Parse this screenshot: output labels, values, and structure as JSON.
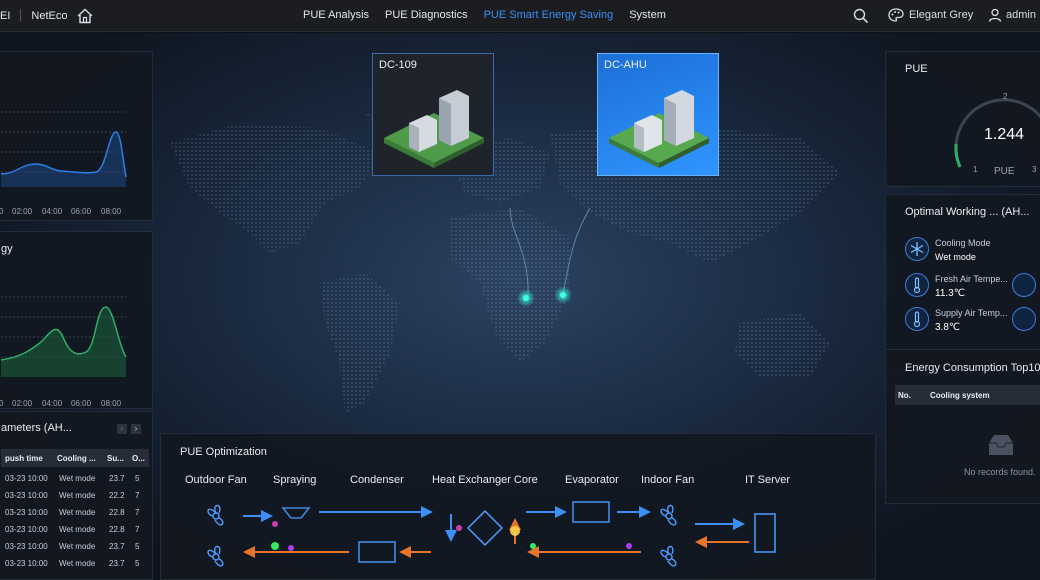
{
  "topbar": {
    "brand": "EI",
    "product": "NetEco",
    "nav": [
      "PUE Analysis",
      "PUE Diagnostics",
      "PUE Smart Energy Saving",
      "System"
    ],
    "active_nav": "PUE Smart Energy Saving",
    "theme": "Elegant Grey",
    "user": "admin"
  },
  "left_panels": {
    "panel2_title": "gy",
    "chart1_ticks": [
      "0",
      "02:00",
      "04:00",
      "06:00",
      "08:00"
    ],
    "chart2_ticks": [
      "0",
      "02:00",
      "04:00",
      "06:00",
      "08:00"
    ],
    "params_title": "ameters (AH...",
    "params_columns": [
      "push time",
      "Cooling ...",
      "Su...",
      "O..."
    ],
    "params_rows": [
      [
        "03-23 10:00",
        "Wet mode",
        "23.7",
        "5"
      ],
      [
        "03-23 10:00",
        "Wet mode",
        "22.2",
        "7"
      ],
      [
        "03-23 10:00",
        "Wet mode",
        "22.8",
        "7"
      ],
      [
        "03-23 10:00",
        "Wet mode",
        "22.8",
        "7"
      ],
      [
        "03-23 10:00",
        "Wet mode",
        "23.7",
        "5"
      ],
      [
        "03-23 10:00",
        "Wet mode",
        "23.7",
        "5"
      ]
    ]
  },
  "dc_cards": [
    {
      "label": "DC-109",
      "selected": false
    },
    {
      "label": "DC-AHU",
      "selected": true
    }
  ],
  "pue": {
    "title": "PUE",
    "value": "1.244",
    "unit": "PUE",
    "scale": [
      "1",
      "2",
      "3"
    ]
  },
  "working": {
    "title": "Optimal Working ... (AH...",
    "items": [
      {
        "name": "Cooling Mode",
        "value": "Wet mode",
        "icon": "snowflake-icon"
      },
      {
        "name": "Fresh Air Tempe...",
        "value": "11.3℃",
        "icon": "thermometer-icon"
      },
      {
        "name": "Supply Air Temp...",
        "value": "3.8℃",
        "icon": "thermometer-icon"
      }
    ]
  },
  "energy_top": {
    "title": "Energy Consumption Top10",
    "columns": [
      "No.",
      "Cooling system"
    ],
    "empty": "No records found."
  },
  "optimization": {
    "title": "PUE Optimization",
    "labels": [
      "Outdoor Fan",
      "Spraying",
      "Condenser",
      "Heat Exchanger Core",
      "Evaporator",
      "Indoor Fan",
      "IT Server"
    ]
  },
  "colors": {
    "accent_blue": "#3c8ff5",
    "line_blue": "#2a7fe6",
    "line_green": "#2fae68",
    "arrow_orange": "#e8742a"
  }
}
